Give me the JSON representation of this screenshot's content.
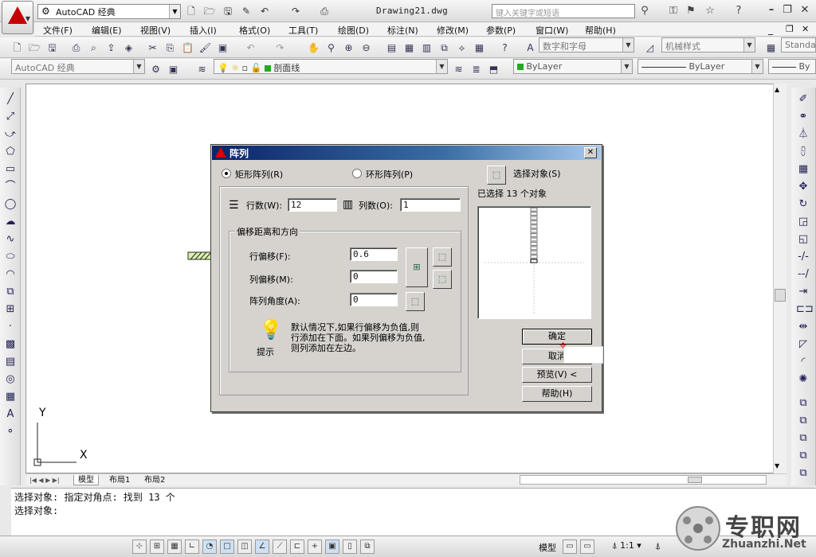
{
  "app": {
    "workspace": "AutoCAD 经典",
    "document_title": "Drawing21.dwg",
    "search_placeholder": "键入关键字或短语"
  },
  "menu": [
    "文件(F)",
    "编辑(E)",
    "视图(V)",
    "插入(I)",
    "格式(O)",
    "工具(T)",
    "绘图(D)",
    "标注(N)",
    "修改(M)",
    "参数(P)",
    "窗口(W)",
    "帮助(H)"
  ],
  "toolbar2": {
    "text_style": "数字和字母",
    "dim_style": "机械样式",
    "table_style": "Standa"
  },
  "toolbar3": {
    "workspace_combo": "AutoCAD 经典",
    "layer": "剖面线",
    "color": "ByLayer",
    "linetype": "ByLayer",
    "lineweight": "By"
  },
  "canvas": {
    "ucs_y": "Y",
    "ucs_x": "X"
  },
  "layout_tabs": [
    "模型",
    "布局1",
    "布局2"
  ],
  "command_line": [
    "选择对象: 指定对角点: 找到 13 个",
    "选择对象:"
  ],
  "status_bar": {
    "space": "模型",
    "scale": "1:1"
  },
  "watermark": {
    "brand": "专职网",
    "url": "Zhuanzhi.Net"
  },
  "dialog": {
    "title": "阵列",
    "rect_array": "矩形阵列(R)",
    "polar_array": "环形阵列(P)",
    "array_type": "rectangular",
    "select_objects": "选择对象(S)",
    "selected_info": "已选择 13 个对象",
    "rows_label": "行数(W):",
    "rows_value": "12",
    "cols_label": "列数(O):",
    "cols_value": "1",
    "offset_group": "偏移距离和方向",
    "row_offset_label": "行偏移(F):",
    "row_offset_value": "0.6",
    "col_offset_label": "列偏移(M):",
    "col_offset_value": "0",
    "angle_label": "阵列角度(A):",
    "angle_value": "0",
    "hint_line1": "默认情况下,如果行偏移为负值,则",
    "hint_line2": "行添加在下面。如果列偏移为负值,",
    "hint_line3": "则列添加在左边。",
    "hint_label": "提示",
    "ok": "确定",
    "cancel": "取消",
    "preview": "预览(V) <",
    "help": "帮助(H)",
    "preview_count": 13
  }
}
